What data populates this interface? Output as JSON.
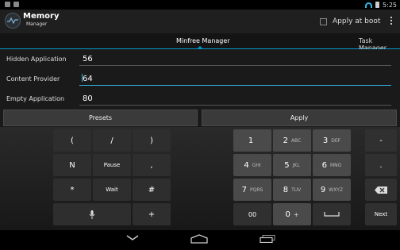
{
  "status": {
    "time": "5:25"
  },
  "app": {
    "title": "Memory",
    "subtitle": "Manager"
  },
  "actions": {
    "apply_at_boot_label": "Apply at boot"
  },
  "tabs": [
    {
      "label": "Minfree Manager",
      "active": true
    },
    {
      "label": "Task Manager",
      "active": false
    }
  ],
  "fields": [
    {
      "label": "Hidden Application",
      "value": "56"
    },
    {
      "label": "Content Provider",
      "value": "64"
    },
    {
      "label": "Empty Application",
      "value": "80"
    }
  ],
  "buttons": {
    "presets": "Presets",
    "apply": "Apply"
  },
  "keyboard": {
    "symbols": [
      "(",
      "/",
      ")",
      "N",
      "Pause",
      ",",
      "*",
      "Wait",
      "#",
      "+"
    ],
    "digits": [
      {
        "d": "1",
        "l": ""
      },
      {
        "d": "2",
        "l": "ABC"
      },
      {
        "d": "3",
        "l": "DEF"
      },
      {
        "d": "4",
        "l": "GHI"
      },
      {
        "d": "5",
        "l": "JKL"
      },
      {
        "d": "6",
        "l": "MNO"
      },
      {
        "d": "7",
        "l": "PQRS"
      },
      {
        "d": "8",
        "l": "TUV"
      },
      {
        "d": "9",
        "l": "WXYZ"
      },
      {
        "d": "00",
        "l": ""
      },
      {
        "d": "0",
        "l": "+"
      }
    ],
    "side": [
      "-",
      ".",
      "Next"
    ]
  },
  "colors": {
    "accent": "#33b5e5",
    "background": "#1a1a1a"
  }
}
